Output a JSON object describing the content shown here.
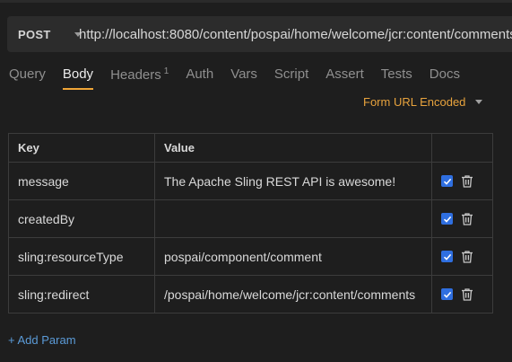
{
  "request": {
    "method": "POST",
    "url": "http://localhost:8080/content/pospai/home/welcome/jcr:content/comments"
  },
  "tabs": [
    {
      "label": "Query",
      "badge": ""
    },
    {
      "label": "Body",
      "badge": ""
    },
    {
      "label": "Headers",
      "badge": "1"
    },
    {
      "label": "Auth",
      "badge": ""
    },
    {
      "label": "Vars",
      "badge": ""
    },
    {
      "label": "Script",
      "badge": ""
    },
    {
      "label": "Assert",
      "badge": ""
    },
    {
      "label": "Tests",
      "badge": ""
    },
    {
      "label": "Docs",
      "badge": ""
    }
  ],
  "active_tab": "Body",
  "body_mode": "Form URL Encoded",
  "table": {
    "headers": {
      "key": "Key",
      "value": "Value"
    },
    "rows": [
      {
        "key": "message",
        "value": "The Apache Sling REST API is awesome!",
        "enabled": true
      },
      {
        "key": "createdBy",
        "value": "",
        "enabled": true
      },
      {
        "key": "sling:resourceType",
        "value": "pospai/component/comment",
        "enabled": true
      },
      {
        "key": "sling:redirect",
        "value": "/pospai/home/welcome/jcr:content/comments",
        "enabled": true
      }
    ]
  },
  "add_param_label": "+ Add Param",
  "colors": {
    "background": "#1e1e1e",
    "accent_orange": "#f0a537",
    "checkbox_blue": "#2f6fe0",
    "link_blue": "#5b9bd8"
  },
  "icons": [
    "chevron-down-icon",
    "checkbox-checked-icon",
    "trash-icon"
  ]
}
